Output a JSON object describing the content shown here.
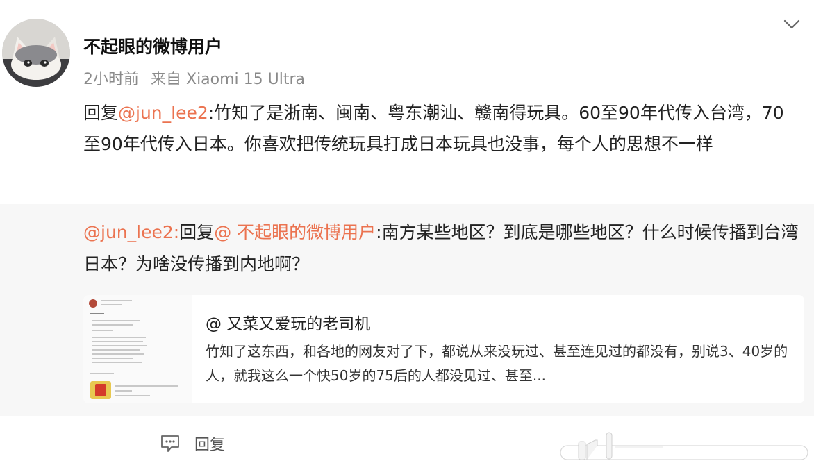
{
  "post": {
    "username": "不起眼的微博用户",
    "time": "2小时前",
    "source": "来自 Xiaomi 15 Ultra",
    "reply_prefix": "回复",
    "reply_mention": "@jun_lee2",
    "reply_body": ":竹知了是浙南、闽南、粤东潮汕、赣南得玩具。60至90年代传入台湾，70至90年代传入日本。你喜欢把传统玩具打成日本玩具也没事，每个人的思想不一样"
  },
  "quote": {
    "author_mention": "@jun_lee2:",
    "reply_prefix": "回复",
    "reply_mention": "@ 不起眼的微博用户",
    "body": ":南方某些地区？到底是哪些地区？什么时候传播到台湾日本？为啥没传播到内地啊？",
    "card": {
      "title": "@ 又菜又爱玩的老司机",
      "description": "竹知了这东西，和各地的网友对了下，都说从来没玩过、甚至连见过的都没有，别说3、40岁的人，就我这么一个快50岁的75后的人都没见过、甚至..."
    }
  },
  "footer": {
    "reply_label": "回复"
  },
  "icons": {
    "more": "chevron-down-icon",
    "reply": "comment-icon",
    "like": "thumbs-up-icon"
  },
  "colors": {
    "mention": "#eb7350",
    "quote_background": "#f7f7f7",
    "meta_text": "#8a8a8a"
  }
}
